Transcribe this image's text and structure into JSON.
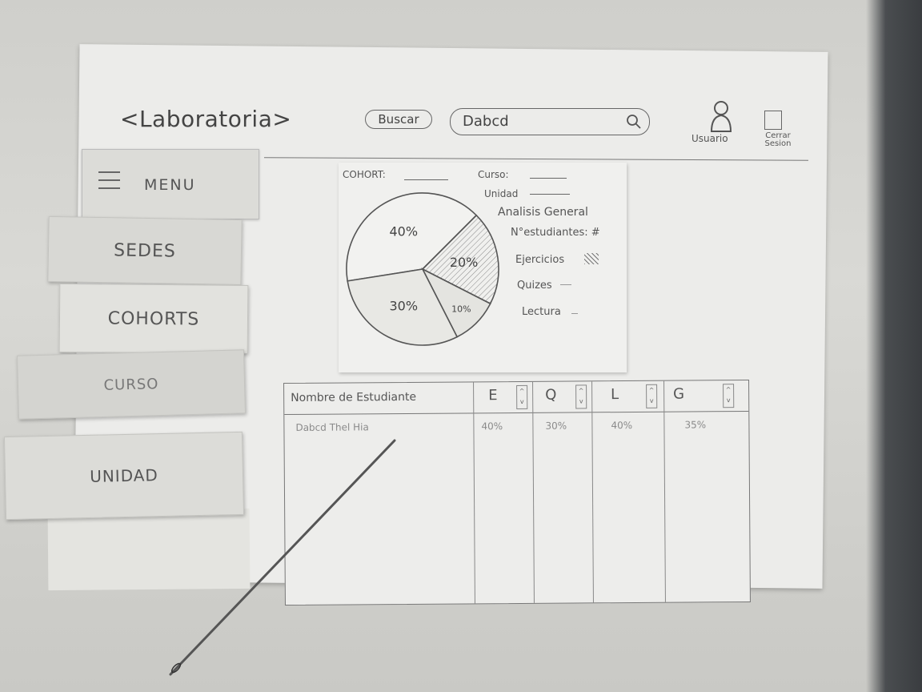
{
  "header": {
    "logo": "<Laboratoria>",
    "search_button": "Buscar",
    "search_value": "Dabcd",
    "user_label": "Usuario",
    "logout_label": "Cerrar Sesion"
  },
  "sidebar": {
    "menu_label": "MENU",
    "items": [
      {
        "label": "SEDES"
      },
      {
        "label": "COHORTS"
      },
      {
        "label": "CURSO"
      },
      {
        "label": "UNIDAD"
      }
    ]
  },
  "analysis": {
    "cohort_label": "COHORT:",
    "curso_label": "Curso:",
    "unidad_label": "Unidad",
    "title": "Analisis General",
    "students": "N°estudiantes: #",
    "ejercicios": "Ejercicios",
    "quizes": "Quizes",
    "lectura": "Lectura"
  },
  "chart_data": {
    "type": "pie",
    "slices": [
      {
        "label": "40%",
        "value": 40
      },
      {
        "label": "20%",
        "value": 20
      },
      {
        "label": "10%",
        "value": 10
      },
      {
        "label": "30%",
        "value": 30
      }
    ]
  },
  "table": {
    "headers": [
      "Nombre de Estudiante",
      "E",
      "Q",
      "L",
      "G"
    ],
    "rows": [
      [
        "Dabcd Thel Hia",
        "40%",
        "30%",
        "40%",
        "35%"
      ]
    ]
  }
}
